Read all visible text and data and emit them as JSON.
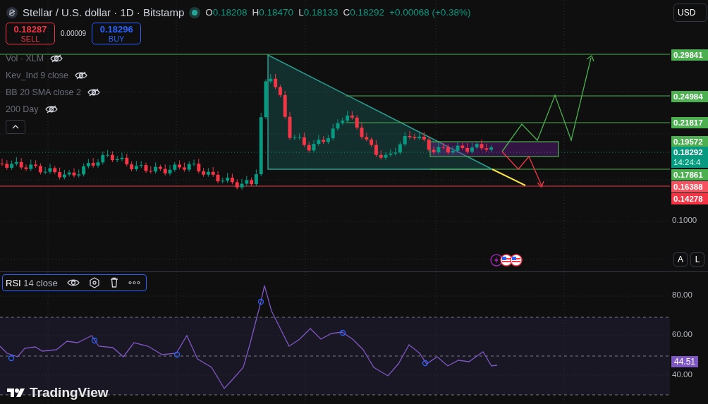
{
  "header": {
    "title": "Stellar / U.S. dollar · 1D · Bitstamp",
    "market_open": true,
    "ohlc": [
      {
        "label": "O",
        "value": "0.18208"
      },
      {
        "label": "H",
        "value": "0.18470"
      },
      {
        "label": "L",
        "value": "0.18133"
      },
      {
        "label": "C",
        "value": "0.18292"
      }
    ],
    "change": "+0.00068 (+0.38%)"
  },
  "trade": {
    "sell": {
      "price": "0.18287",
      "label": "SELL"
    },
    "spread": "0.00009",
    "buy": {
      "price": "0.18296",
      "label": "BUY"
    }
  },
  "legends": [
    {
      "text": "Vol · XLM",
      "hidden": true
    },
    {
      "text": "Kev_Ind 9 close",
      "hidden": true
    },
    {
      "text": "BB 20 SMA close 2",
      "hidden": true
    },
    {
      "text": "200 Day",
      "hidden": true
    }
  ],
  "currency": "USD",
  "price_axis": [
    {
      "kind": "level",
      "text": "0.29841",
      "color": "#4caf50"
    },
    {
      "kind": "level",
      "text": "0.24984",
      "color": "#4caf50"
    },
    {
      "kind": "level",
      "text": "0.21817",
      "color": "#4caf50"
    },
    {
      "kind": "level",
      "text": "0.19572",
      "color": "#4caf50"
    },
    {
      "kind": "level",
      "text": "0.18292",
      "sub": "14:24:4",
      "color": "#089981"
    },
    {
      "kind": "level",
      "text": "0.17861",
      "color": "#4caf50"
    },
    {
      "kind": "level",
      "text": "0.16388",
      "color": "#f7525f"
    },
    {
      "kind": "level",
      "text": "0.14278",
      "color": "#f23645"
    },
    {
      "kind": "tick",
      "text": "0.1000"
    }
  ],
  "scale_buttons": [
    "A",
    "L"
  ],
  "rsi": {
    "name": "RSI",
    "params": "14 close",
    "axis": [
      "80.00",
      "60.00",
      "40.00"
    ],
    "value": "44.51"
  },
  "brand": "TradingView"
}
